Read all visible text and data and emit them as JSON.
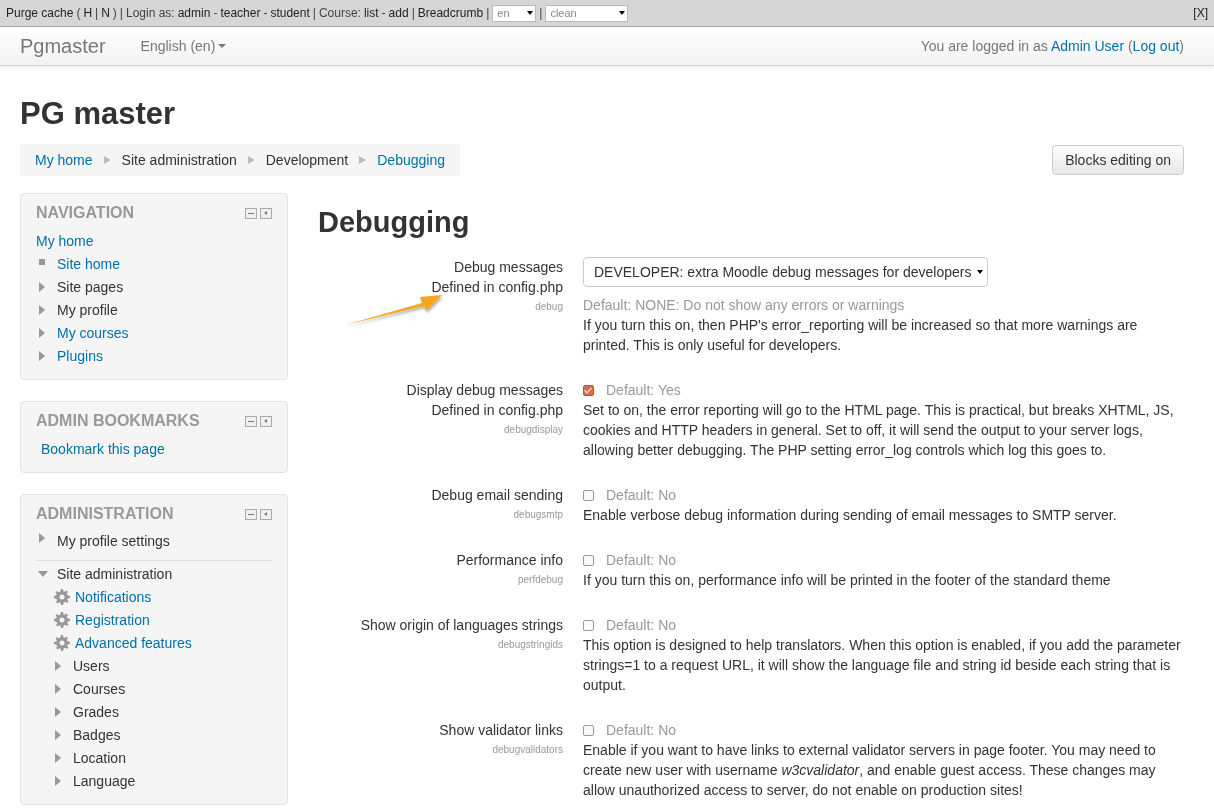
{
  "debug_bar": {
    "parts": [
      {
        "kind": "link",
        "text": "Purge cache"
      },
      {
        "kind": "plain",
        "text": "("
      },
      {
        "kind": "link",
        "text": "H"
      },
      {
        "kind": "plain",
        "text": "|"
      },
      {
        "kind": "link",
        "text": "N"
      },
      {
        "kind": "plain",
        "text": ")"
      },
      {
        "kind": "plain",
        "text": "|"
      },
      {
        "kind": "plain",
        "text": "Login as:"
      },
      {
        "kind": "link",
        "text": "admin"
      },
      {
        "kind": "plain",
        "text": "-"
      },
      {
        "kind": "link",
        "text": "teacher"
      },
      {
        "kind": "plain",
        "text": "-"
      },
      {
        "kind": "link",
        "text": "student"
      },
      {
        "kind": "plain",
        "text": "|"
      },
      {
        "kind": "plain",
        "text": "Course:"
      },
      {
        "kind": "link",
        "text": "list"
      },
      {
        "kind": "plain",
        "text": "-"
      },
      {
        "kind": "link",
        "text": "add"
      },
      {
        "kind": "plain",
        "text": "|"
      },
      {
        "kind": "link",
        "text": "Breadcrumb"
      },
      {
        "kind": "plain",
        "text": "|"
      },
      {
        "kind": "select",
        "text": "en"
      },
      {
        "kind": "plain",
        "text": "|"
      },
      {
        "kind": "select",
        "text": "clean"
      }
    ],
    "close": "[X]"
  },
  "navbar": {
    "brand": "Pgmaster",
    "language": "English (en)",
    "login_text": "You are logged in as",
    "user": "Admin User",
    "logout_open": "(",
    "logout": "Log out",
    "logout_close": ")"
  },
  "page_title": "PG master",
  "breadcrumb": [
    {
      "text": "My home",
      "link": true
    },
    {
      "text": "Site administration",
      "link": false
    },
    {
      "text": "Development",
      "link": false
    },
    {
      "text": "Debugging",
      "link": true
    }
  ],
  "edit_button": "Blocks editing on",
  "blocks": [
    {
      "title": "NAVIGATION",
      "items": [
        {
          "text": "My home",
          "kind": "plain",
          "link": true
        },
        {
          "text": "Site home",
          "kind": "leaf",
          "link": true
        },
        {
          "text": "Site pages",
          "kind": "collapsed",
          "link": false
        },
        {
          "text": "My profile",
          "kind": "collapsed",
          "link": false
        },
        {
          "text": "My courses",
          "kind": "collapsed",
          "link": true
        },
        {
          "text": "Plugins",
          "kind": "collapsed",
          "link": true
        }
      ]
    },
    {
      "title": "ADMIN BOOKMARKS",
      "items": [
        {
          "text": "Bookmark this page",
          "kind": "plain",
          "link": true
        }
      ]
    },
    {
      "title": "ADMINISTRATION",
      "items": [
        {
          "text": "My profile settings",
          "kind": "collapsed",
          "link": false,
          "divider": true
        },
        {
          "text": "Site administration",
          "kind": "expanded",
          "link": false,
          "children": [
            {
              "text": "Notifications",
              "kind": "gear",
              "link": true
            },
            {
              "text": "Registration",
              "kind": "gear",
              "link": true
            },
            {
              "text": "Advanced features",
              "kind": "gear",
              "link": true
            },
            {
              "text": "Users",
              "kind": "collapsed",
              "link": false
            },
            {
              "text": "Courses",
              "kind": "collapsed",
              "link": false
            },
            {
              "text": "Grades",
              "kind": "collapsed",
              "link": false
            },
            {
              "text": "Badges",
              "kind": "collapsed",
              "link": false
            },
            {
              "text": "Location",
              "kind": "collapsed",
              "link": false
            },
            {
              "text": "Language",
              "kind": "collapsed",
              "link": false
            }
          ]
        }
      ]
    }
  ],
  "heading": "Debugging",
  "settings": [
    {
      "kind": "select",
      "label": "Debug messages",
      "defined": "Defined in config.php",
      "name": "debug",
      "value": "DEVELOPER: extra Moodle debug messages for developers",
      "default": "Default: NONE: Do not show any errors or warnings",
      "description": "If you turn this on, then PHP's error_reporting will be increased so that more warnings are printed. This is only useful for developers."
    },
    {
      "kind": "checkbox",
      "label": "Display debug messages",
      "defined": "Defined in config.php",
      "name": "debugdisplay",
      "checked": true,
      "default": "Default: Yes",
      "description": "Set to on, the error reporting will go to the HTML page. This is practical, but breaks XHTML, JS, cookies and HTTP headers in general. Set to off, it will send the output to your server logs, allowing better debugging. The PHP setting error_log controls which log this goes to."
    },
    {
      "kind": "checkbox",
      "label": "Debug email sending",
      "name": "debugsmtp",
      "checked": false,
      "default": "Default: No",
      "description": "Enable verbose debug information during sending of email messages to SMTP server."
    },
    {
      "kind": "checkbox",
      "label": "Performance info",
      "name": "perfdebug",
      "checked": false,
      "default": "Default: No",
      "description": "If you turn this on, performance info will be printed in the footer of the standard theme"
    },
    {
      "kind": "checkbox",
      "label": "Show origin of languages strings",
      "name": "debugstringids",
      "checked": false,
      "default": "Default: No",
      "description": "This option is designed to help translators. When this option is enabled, if you add the parameter strings=1 to a request URL, it will show the language file and string id beside each string that is output."
    },
    {
      "kind": "checkbox",
      "label": "Show validator links",
      "name": "debugvalidators",
      "checked": false,
      "default": "Default: No",
      "description": "Enable if you want to have links to external validator servers in page footer. You may need to create new user with username *w3cvalidator*, and enable guest access. These changes may allow unauthorized access to server, do not enable on production sites!"
    }
  ]
}
